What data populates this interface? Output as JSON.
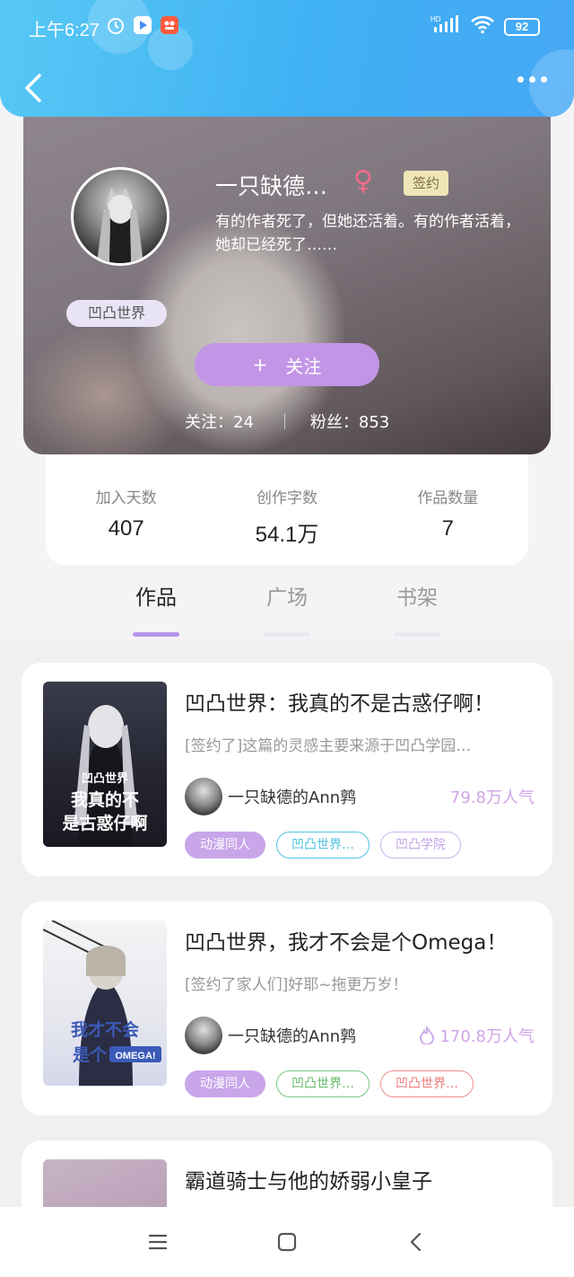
{
  "status_bar": {
    "time": "上午6:27",
    "battery": "92",
    "network": "HD"
  },
  "header": {
    "back_icon": "chevron-left-icon",
    "more_icon": "more-dots-icon"
  },
  "profile": {
    "name": "一只缺德…",
    "gender_symbol": "♀",
    "sign_tag": "签约",
    "bio": "有的作者死了，但她还活着。有的作者活着，她却已经死了……",
    "world_badge": "凹凸世界",
    "follow_button": "关注",
    "follow_plus": "+",
    "following_label": "关注：24",
    "fans_label": "粉丝：853"
  },
  "stats": [
    {
      "label": "加入天数",
      "value": "407"
    },
    {
      "label": "创作字数",
      "value": "54.1万"
    },
    {
      "label": "作品数量",
      "value": "7"
    }
  ],
  "tabs": [
    {
      "label": "作品",
      "active": true
    },
    {
      "label": "广场",
      "active": false
    },
    {
      "label": "书架",
      "active": false
    }
  ],
  "books": [
    {
      "title": "凹凸世界：我真的不是古惑仔啊！",
      "desc": "[签约了]这篇的灵感主要来源于凹凸学园…",
      "author": "一只缺德的Ann鹑",
      "popularity": "79.8万人气",
      "tags": [
        "动漫同人",
        "凹凸世界…",
        "凹凸学院"
      ],
      "cover_text": "凹凸世界 我真的不是古惑仔啊"
    },
    {
      "title": "凹凸世界，我才不会是个Omega！",
      "desc": "[签约了家人们]好耶~拖更万岁！",
      "author": "一只缺德的Ann鹑",
      "popularity": "170.8万人气",
      "tags": [
        "动漫同人",
        "凹凸世界…",
        "凹凸世界…"
      ],
      "cover_text": "我才不会是个OMEGA!"
    },
    {
      "title": "霸道骑士与他的娇弱小皇子"
    }
  ],
  "colors": {
    "header_blue": "#3fb0f3",
    "accent_purple": "#c295e6",
    "popularity": "#d0a4e8"
  },
  "nav": {
    "menu_icon": "menu-icon",
    "home_icon": "home-square-icon",
    "back_icon": "back-triangle-icon"
  }
}
